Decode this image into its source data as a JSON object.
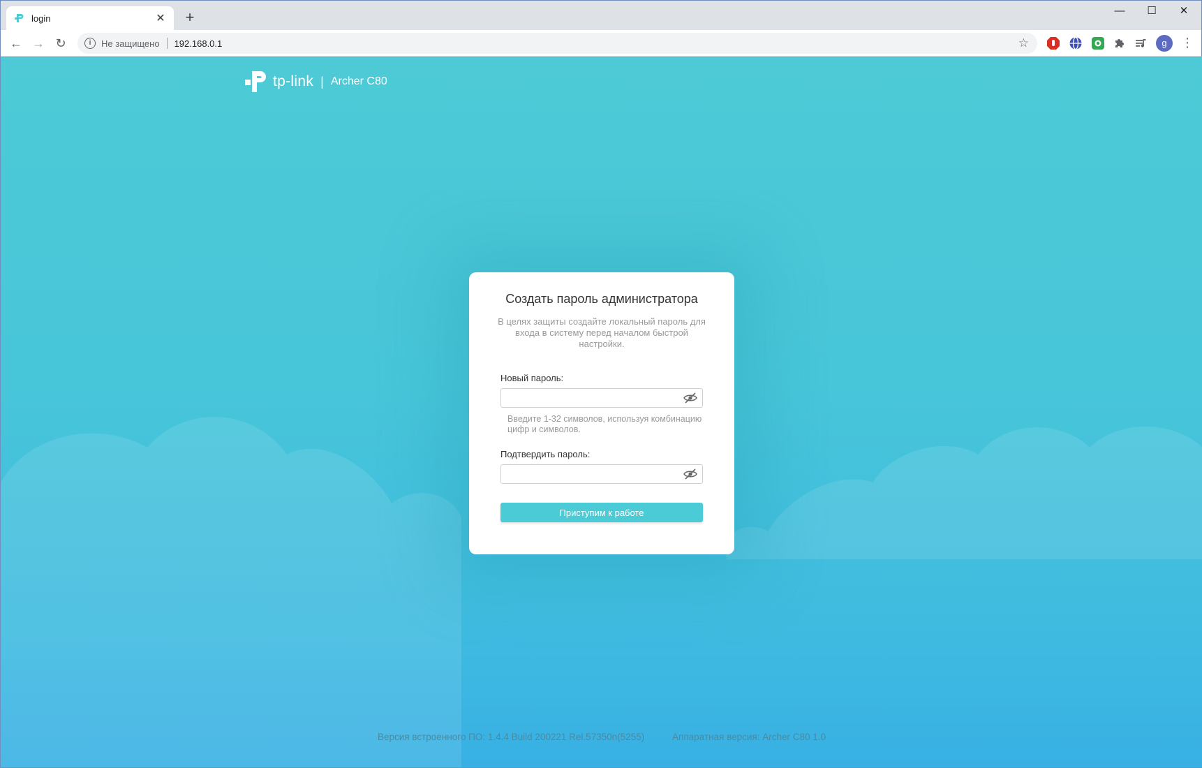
{
  "browser": {
    "tab_title": "login",
    "new_tab": "+",
    "security_label": "Не защищено",
    "url": "192.168.0.1",
    "profile_initial": "g",
    "minimize": "—",
    "maximize": "☐",
    "close": "✕",
    "tab_close": "✕",
    "back": "←",
    "forward": "→",
    "reload": "↻",
    "bookmark": "☆",
    "menu": "⋮",
    "info": "i"
  },
  "header": {
    "brand": "tp-link",
    "separator": "|",
    "model": "Archer C80"
  },
  "form": {
    "title": "Создать пароль администратора",
    "description": "В целях защиты создайте локальный пароль для входа в систему перед началом быстрой настройки.",
    "new_password_label": "Новый пароль:",
    "new_password_value": "",
    "new_password_hint": "Введите 1-32 символов, используя комбинацию цифр и символов.",
    "confirm_password_label": "Подтвердить пароль:",
    "confirm_password_value": "",
    "submit_label": "Приступим к работе"
  },
  "footer": {
    "firmware": "Версия встроенного ПО: 1.4.4 Build 200221 Rel.57350n(5255)",
    "hardware": "Аппаратная версия: Archer C80 1.0"
  },
  "colors": {
    "accent": "#4acbd6",
    "background_top": "#4dcad6",
    "background_bottom": "#38b0e4"
  }
}
